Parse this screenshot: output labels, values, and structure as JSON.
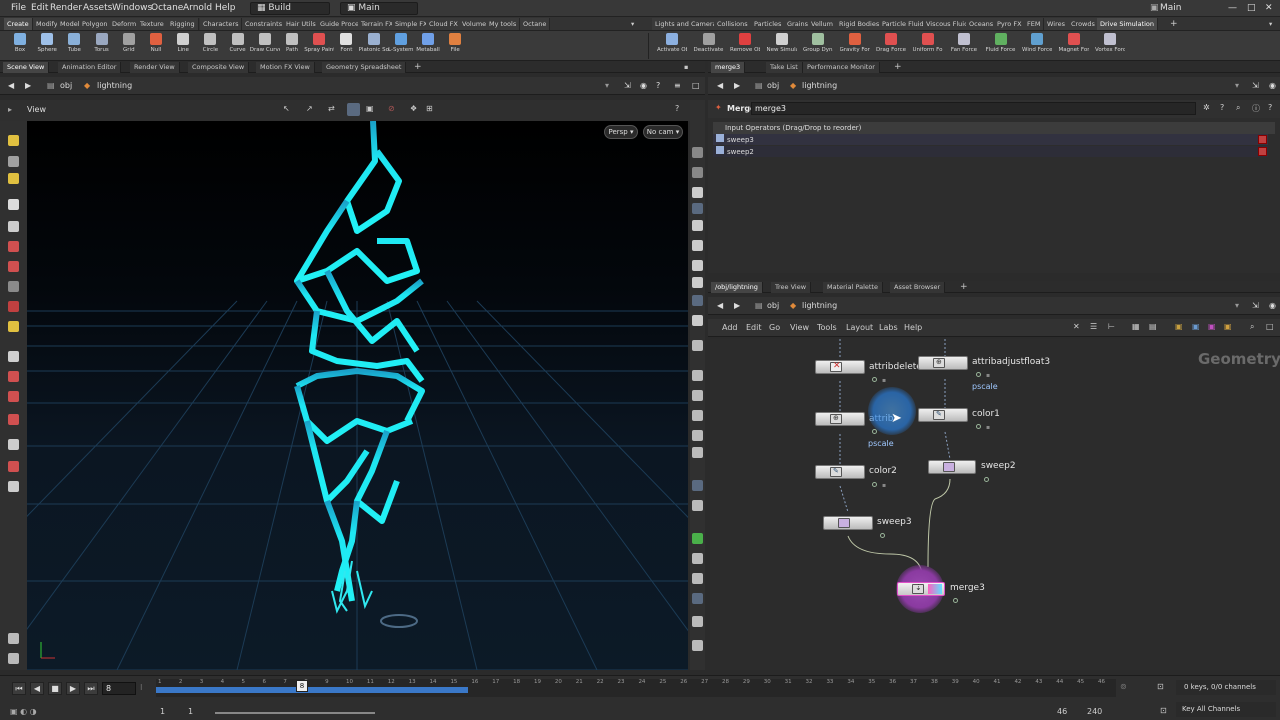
{
  "menubar": {
    "items": [
      "File",
      "Edit",
      "Render",
      "Assets",
      "Windows",
      "Octane",
      "Arnold",
      "Help"
    ],
    "desktop": "Build",
    "main": "Main",
    "right_main": "Main"
  },
  "shelf_tabs_left": [
    "Create",
    "Modify",
    "Model",
    "Polygon",
    "Deform",
    "Texture",
    "Rigging",
    "Characters",
    "Constraints",
    "Hair Utils",
    "Guide Process",
    "Terrain FX",
    "Simple FX",
    "Cloud FX",
    "Volume",
    "My tools",
    "Octane"
  ],
  "shelf_tabs_right": [
    "Lights and Cameras",
    "Collisions",
    "Particles",
    "Grains",
    "Vellum",
    "Rigid Bodies",
    "Particle Fluids",
    "Viscous Fluids",
    "Oceans",
    "Pyro FX",
    "FEM",
    "Wires",
    "Crowds",
    "Drive Simulation"
  ],
  "tools_left": [
    {
      "label": "Box",
      "icon": "box-icon",
      "color": "#7fb0e0"
    },
    {
      "label": "Sphere",
      "icon": "sphere-icon",
      "color": "#9ec0e8"
    },
    {
      "label": "Tube",
      "icon": "tube-icon",
      "color": "#8ab0d8"
    },
    {
      "label": "Torus",
      "icon": "torus-icon",
      "color": "#9aa8c0"
    },
    {
      "label": "Grid",
      "icon": "grid-icon",
      "color": "#a0a0a0"
    },
    {
      "label": "Null",
      "icon": "null-icon",
      "color": "#e06040"
    },
    {
      "label": "Line",
      "icon": "line-icon",
      "color": "#d0d0d0"
    },
    {
      "label": "Circle",
      "icon": "circle-icon",
      "color": "#c0c0c0"
    },
    {
      "label": "Curve",
      "icon": "curve-icon",
      "color": "#c0c0c0"
    },
    {
      "label": "Draw Curve",
      "icon": "draw-curve-icon",
      "color": "#c0c0c0"
    },
    {
      "label": "Path",
      "icon": "path-icon",
      "color": "#c0c0c0"
    },
    {
      "label": "Spray Paint",
      "icon": "spray-paint-icon",
      "color": "#e05050"
    },
    {
      "label": "Font",
      "icon": "font-icon",
      "color": "#e0e0e0"
    },
    {
      "label": "Platonic Solids",
      "icon": "platonic-icon",
      "color": "#9ab0d0"
    },
    {
      "label": "L-System",
      "icon": "lsystem-icon",
      "color": "#60a0e0"
    },
    {
      "label": "Metaball",
      "icon": "metaball-icon",
      "color": "#70a0e8"
    },
    {
      "label": "File",
      "icon": "file-icon",
      "color": "#e08040"
    }
  ],
  "tools_right": [
    {
      "label": "Activate Objects",
      "icon": "activate-icon",
      "color": "#8cb0e0"
    },
    {
      "label": "Deactivate Objects",
      "icon": "deactivate-icon",
      "color": "#a0a0a0"
    },
    {
      "label": "Remove Objects fro...",
      "icon": "remove-icon",
      "color": "#e04040"
    },
    {
      "label": "New Simulation",
      "icon": "new-sim-icon",
      "color": "#d0d0d0"
    },
    {
      "label": "Group Dynamic Ob...",
      "icon": "group-icon",
      "color": "#a0c0a0"
    },
    {
      "label": "Gravity Force",
      "icon": "gravity-icon",
      "color": "#e06040"
    },
    {
      "label": "Drag Force",
      "icon": "drag-force-icon",
      "color": "#e05050"
    },
    {
      "label": "Uniform Force",
      "icon": "uniform-force-icon",
      "color": "#e05050"
    },
    {
      "label": "Fan Force",
      "icon": "fan-force-icon",
      "color": "#c0c0d0"
    },
    {
      "label": "Fluid Force",
      "icon": "fluid-force-icon",
      "color": "#60b060"
    },
    {
      "label": "Wind Force",
      "icon": "wind-force-icon",
      "color": "#60a0d0"
    },
    {
      "label": "Magnet Force",
      "icon": "magnet-force-icon",
      "color": "#e05050"
    },
    {
      "label": "Vortex Force",
      "icon": "vortex-force-icon",
      "color": "#c0c0d0"
    }
  ],
  "left_pane": {
    "tabs": [
      "Scene View",
      "Animation Editor",
      "Render View",
      "Composite View",
      "Motion FX View",
      "Geometry Spreadsheet"
    ],
    "path_root": "obj",
    "path_node": "lightning",
    "view_label": "View",
    "persp_label": "Persp",
    "cam_label": "No cam"
  },
  "right_top_pane": {
    "tabs": [
      "merge3",
      "Take List",
      "Performance Monitor"
    ],
    "path_root": "obj",
    "path_node": "lightning",
    "node_type": "Merge",
    "node_name": "merge3",
    "input_header": "Input Operators (Drag/Drop to reorder)",
    "inputs": [
      "sweep3",
      "sweep2"
    ]
  },
  "network_pane": {
    "tabs": [
      "/obj/lightning",
      "Tree View",
      "Material Palette",
      "Asset Browser"
    ],
    "path_root": "obj",
    "path_node": "lightning",
    "menu": [
      "Add",
      "Edit",
      "Go",
      "View",
      "Tools",
      "Layout",
      "Labs",
      "Help"
    ],
    "context_label": "Geometry",
    "nodes": {
      "attribdelete": "attribdelete",
      "attribadjust_a": "attribadjustfloat3",
      "attribadjust_a_sub": "pscale",
      "attribadjust_b": "attrib",
      "attribadjust_b_sub": "pscale",
      "color1": "color1",
      "color2": "color2",
      "sweep2": "sweep2",
      "sweep3": "sweep3",
      "merge3": "merge3"
    }
  },
  "timeline": {
    "current_frame": "8",
    "ticks": [
      "1",
      "2",
      "3",
      "4",
      "5",
      "6",
      "7",
      "8",
      "9",
      "10",
      "11",
      "12",
      "13",
      "14",
      "15",
      "16",
      "17",
      "18",
      "19",
      "20",
      "21",
      "22",
      "23",
      "24",
      "25",
      "26",
      "27",
      "28",
      "29",
      "30",
      "31",
      "32",
      "33",
      "34",
      "35",
      "36",
      "37",
      "38",
      "39",
      "40",
      "41",
      "42",
      "43",
      "44",
      "45",
      "46"
    ],
    "range_start": "1",
    "range_start2": "1",
    "range_end": "46",
    "range_end2": "240",
    "keys_status": "0 keys, 0/0 channels",
    "key_all": "Key All Channels"
  }
}
